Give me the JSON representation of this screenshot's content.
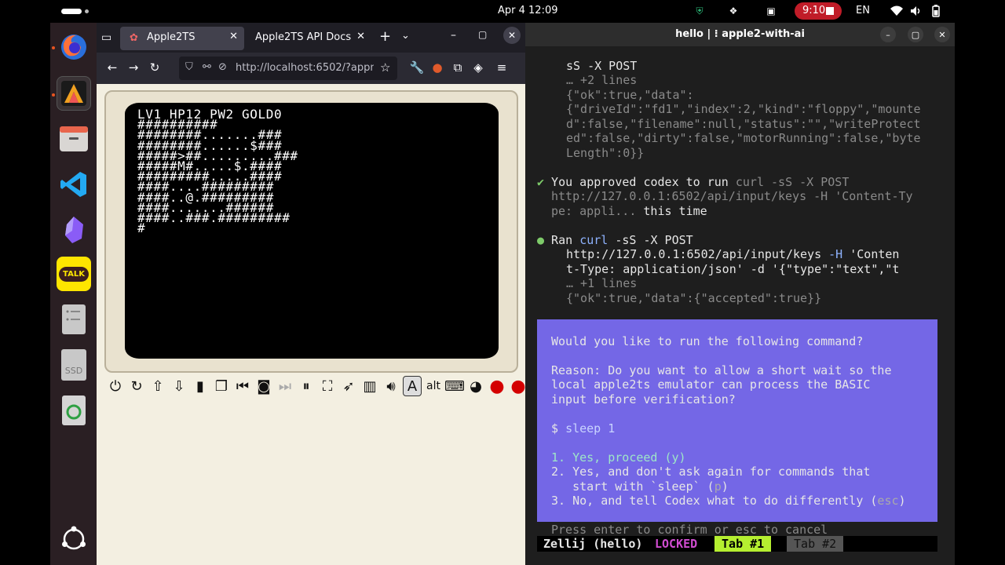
{
  "topbar": {
    "clock": "Apr 4  12:09",
    "recording_time": "9:10",
    "language": "EN"
  },
  "dock": {
    "items": [
      "firefox-icon",
      "alacritty-icon",
      "files-icon",
      "vscode-icon",
      "obsidian-icon",
      "kakaotalk-icon",
      "drive-icon",
      "ssd-icon",
      "trash-icon",
      "show-apps-icon"
    ],
    "kakao_label": "TALK",
    "ssd_label": "SSD"
  },
  "browser": {
    "tabs": [
      {
        "label": "Apple2TS"
      },
      {
        "label": "Apple2TS API Docs"
      }
    ],
    "url": "http://localhost:6502/?appm",
    "screen_lines": [
      "LV1 HP12 PW2 GOLD0",
      "##########",
      "########.......###",
      "########......$###",
      "#####>##.........###",
      "#####M#.....$.####",
      "#########.....####",
      "####....#########",
      "####..@.#########",
      "####.......######",
      "####..###.#########",
      "#"
    ],
    "toolbar_icons": [
      "power-icon",
      "reset-icon",
      "upload-icon",
      "download-icon",
      "clipboard-icon",
      "copy-icon",
      "rewind-icon",
      "camera-icon",
      "fast-forward-icon",
      "pause-icon",
      "fullscreen-icon",
      "rocket-icon",
      "tv-icon",
      "sound-icon",
      "font-a-icon",
      "alt-key-icon",
      "gamepad-icon",
      "palette-icon",
      "red-button-icon",
      "red-button-icon"
    ],
    "alt_label": "alt",
    "font_label": "A"
  },
  "terminal": {
    "title": "hello | ⁝ apple2-with-ai",
    "lines": {
      "l1a": "sS -X POST",
      "l2": "… +2 lines",
      "l3": "{\"ok\":true,\"data\":",
      "l4": "{\"driveId\":\"fd1\",\"index\":2,\"kind\":\"floppy\",\"mounte",
      "l5": "d\":false,\"filename\":null,\"status\":\"\",\"writeProtect",
      "l6": "ed\":false,\"dirty\":false,\"motorRunning\":false,\"byte",
      "l7": "Length\":0}}",
      "approved_check": "✔",
      "approved_a": " You approved codex to run ",
      "approved_b": "curl -sS -X POST",
      "approved_2": "http://127.0.0.1:6502/api/input/keys -H 'Content-Ty",
      "approved_3a": "pe: appli... ",
      "approved_3b": "this time",
      "ran_bullet": "●",
      "ran_a": " Ran ",
      "ran_b": "curl",
      "ran_c": " -sS -X POST",
      "ran_2a": "http://127.0.0.1:6502/api/input/keys ",
      "ran_2b": "-H",
      "ran_2c": " 'Conten",
      "ran_3": "t-Type: application/json' -d '{\"type\":\"text\",\"t",
      "ran_4": "… +1 lines",
      "ran_5": "{\"ok\":true,\"data\":{\"accepted\":true}}"
    },
    "prompt": {
      "question": "Would you like to run the following command?",
      "reason_1": "Reason: Do you want to allow a short wait so the",
      "reason_2": "local apple2ts emulator can process the BASIC",
      "reason_3": "input before verification?",
      "cmd_dollar": "$ ",
      "cmd": "sleep 1",
      "opt1": "1. Yes, proceed (y)",
      "opt2a": "2. Yes, and don't ask again for commands that",
      "opt2b": "   start with `sleep` (",
      "opt2_key": "p",
      "opt2_end": ")",
      "opt3a": "3. No, and tell Codex what to do differently (",
      "opt3_key": "esc",
      "opt3_end": ")"
    },
    "footer": "Press enter to confirm or esc to cancel",
    "zellij": {
      "name": "Zellij (hello) ",
      "locked": "LOCKED",
      "tab1": " Tab #1 ",
      "tab2": " Tab #2 "
    }
  }
}
